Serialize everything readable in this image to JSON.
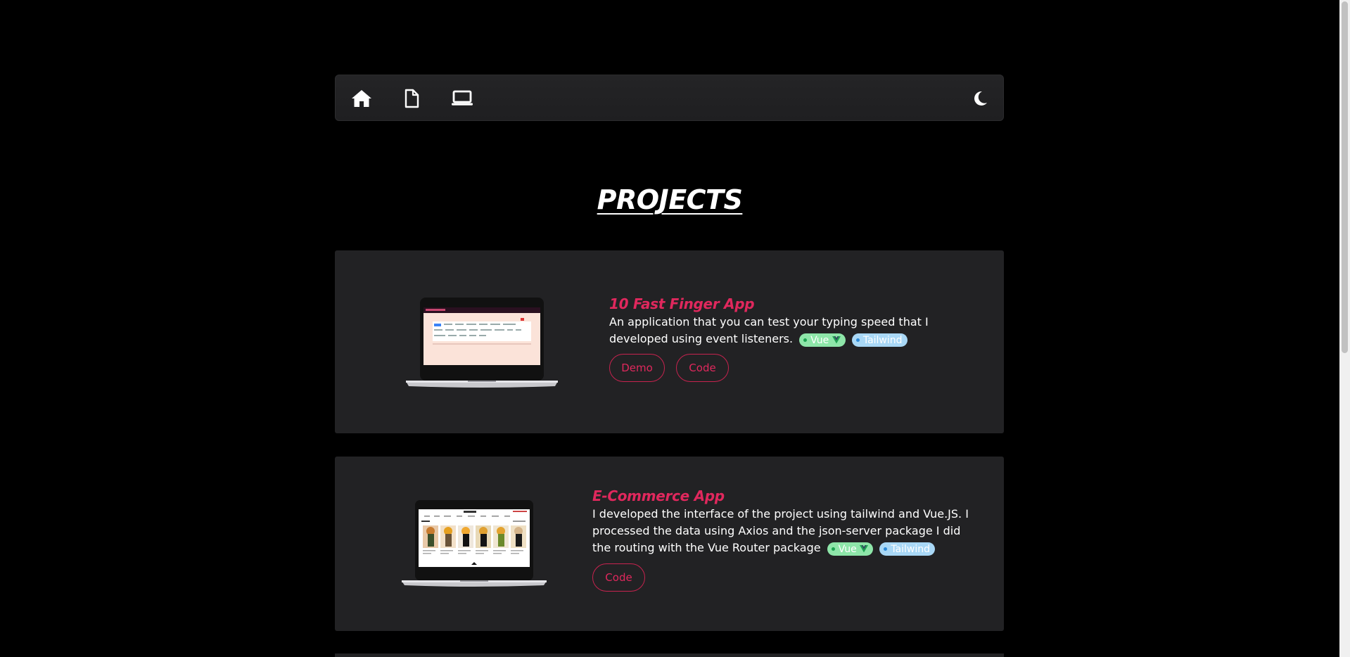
{
  "nav": {
    "items": [
      {
        "icon": "home-icon"
      },
      {
        "icon": "document-icon"
      },
      {
        "icon": "laptop-icon"
      }
    ],
    "theme_toggle_icon": "moon-icon"
  },
  "page_title": "PROJECTS",
  "projects": [
    {
      "title": "10 Fast Finger App",
      "description": "An application that you can test your typing speed that I developed using event listeners.",
      "tags": [
        "Vue",
        "Tailwind"
      ],
      "buttons": [
        "Demo",
        "Code"
      ]
    },
    {
      "title": "E-Commerce App",
      "description": "I developed the interface of the project using tailwind and Vue.JS. I processed the data using Axios and the json-server package I did the routing with the Vue Router package",
      "tags": [
        "Vue",
        "Tailwind"
      ],
      "buttons": [
        "Code"
      ]
    }
  ],
  "colors": {
    "accent": "#e0285d",
    "background": "#000000",
    "card": "#222224",
    "vue_tag": "#8ee6a9",
    "tailwind_tag": "#a9d8f6"
  }
}
